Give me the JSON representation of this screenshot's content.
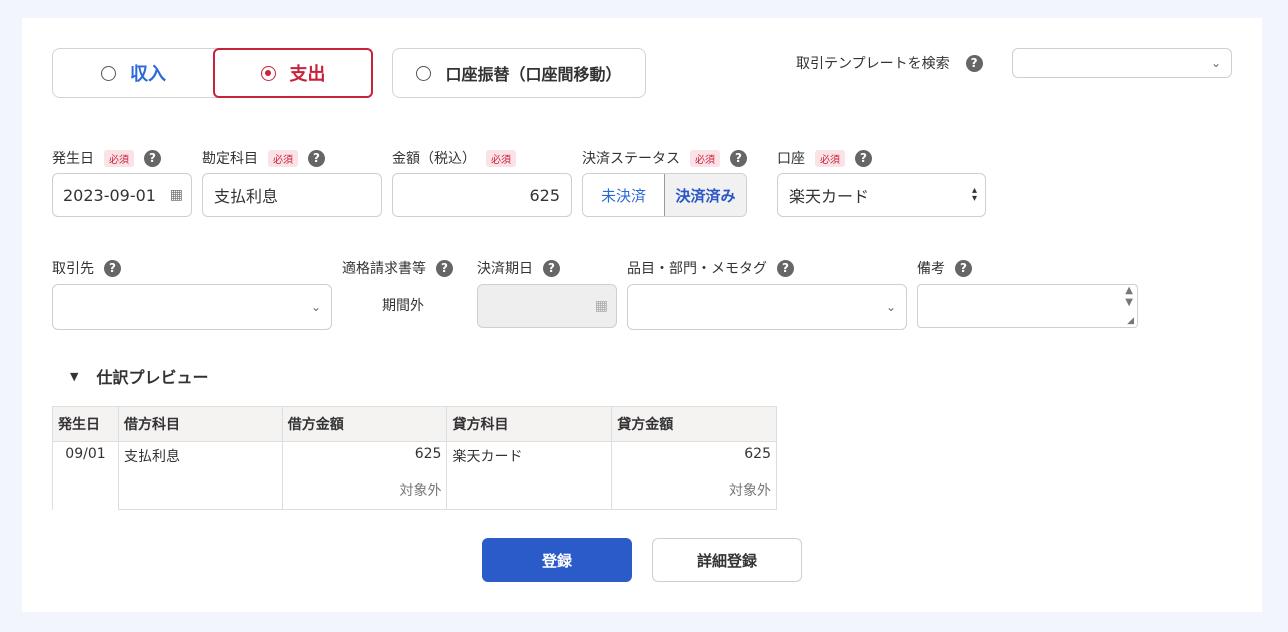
{
  "type_toggle": {
    "income_label": "収入",
    "expense_label": "支出",
    "transfer_label": "口座振替（口座間移動）",
    "selected": "expense"
  },
  "template_search": {
    "label": "取引テンプレートを検索",
    "value": ""
  },
  "help_icon": "?",
  "required_badge": "必須",
  "fields": {
    "date": {
      "label": "発生日",
      "value": "2023-09-01"
    },
    "account_item": {
      "label": "勘定科目",
      "value": "支払利息"
    },
    "amount": {
      "label": "金額（税込）",
      "value": "625"
    },
    "settlement_status": {
      "label": "決済ステータス",
      "options": [
        "未決済",
        "決済済み"
      ],
      "selected": "決済済み"
    },
    "wallet": {
      "label": "口座",
      "value": "楽天カード"
    },
    "partner": {
      "label": "取引先",
      "value": ""
    },
    "qualified_invoice": {
      "label": "適格請求書等",
      "value": "期間外"
    },
    "due_date": {
      "label": "決済期日",
      "value": ""
    },
    "tags": {
      "label": "品目・部門・メモタグ",
      "value": ""
    },
    "memo": {
      "label": "備考",
      "value": ""
    }
  },
  "preview": {
    "title": "仕訳プレビュー",
    "columns": [
      "発生日",
      "借方科目",
      "借方金額",
      "貸方科目",
      "貸方金額"
    ],
    "row": {
      "date": "09/01",
      "debit_item": "支払利息",
      "debit_amount": "625",
      "credit_item": "楽天カード",
      "credit_amount": "625",
      "debit_tax": "対象外",
      "credit_tax": "対象外"
    }
  },
  "actions": {
    "register": "登録",
    "detail_register": "詳細登録"
  },
  "colors": {
    "income": "#2a6ad8",
    "expense": "#c8223c",
    "primary": "#2a5bc9"
  }
}
